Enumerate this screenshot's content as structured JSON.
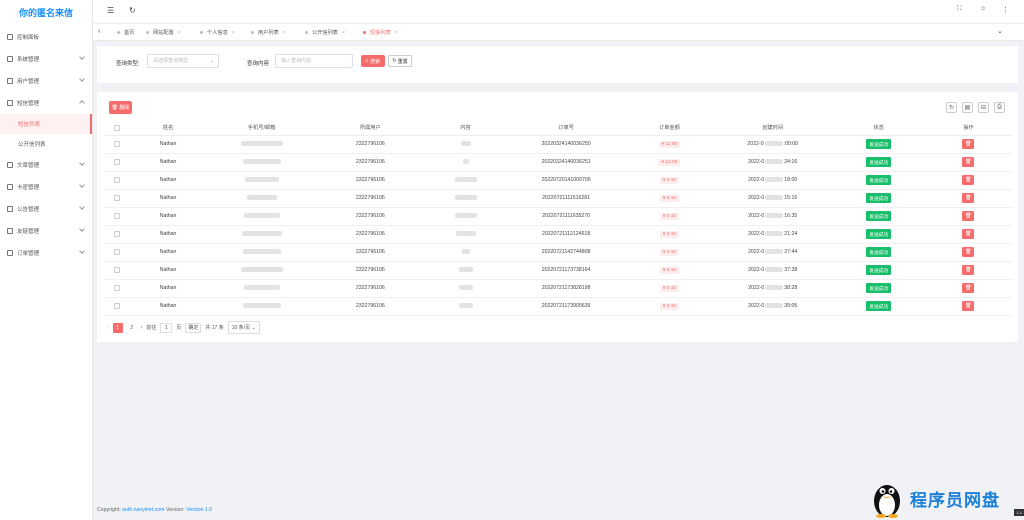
{
  "sidebar": {
    "logo": "你的匿名来信",
    "items": [
      {
        "label": "控制面板",
        "chev": false
      },
      {
        "label": "系统管理",
        "chev": true
      },
      {
        "label": "用户管理",
        "chev": true
      },
      {
        "label": "短信管理",
        "chev": true,
        "open": true
      }
    ],
    "subs": [
      {
        "label": "短信列表",
        "active": true
      },
      {
        "label": "公开信列表",
        "active": false
      }
    ],
    "items2": [
      {
        "label": "文章管理"
      },
      {
        "label": "卡密管理"
      },
      {
        "label": "公告管理"
      },
      {
        "label": "友链管理"
      },
      {
        "label": "订单管理"
      }
    ]
  },
  "tabs": [
    {
      "label": "首页",
      "close": false
    },
    {
      "label": "网站配置",
      "close": true
    },
    {
      "label": "个人信息",
      "close": true
    },
    {
      "label": "用户列表",
      "close": true
    },
    {
      "label": "公开信列表",
      "close": true
    },
    {
      "label": "短信列表",
      "close": true,
      "active": true
    }
  ],
  "search": {
    "type_label": "查询类型:",
    "type_placeholder": "请选择查询类型",
    "content_label": "查询内容",
    "content_placeholder": "输入查询内容",
    "search_btn": "搜索",
    "reset_btn": "重置"
  },
  "panel": {
    "delete_btn": "删除"
  },
  "table": {
    "headers": [
      "",
      "姓名",
      "手机号/邮箱",
      "所属用户",
      "内容",
      "订单号",
      "订单金额",
      "创建时间",
      "状态",
      "操作"
    ],
    "rows": [
      {
        "name": "Nathan",
        "user": "2322796106",
        "order": "20220324140036250",
        "amount": "¥ 11.00",
        "time_a": "2022-0",
        "time_b": ":00:00",
        "status": "发送成功"
      },
      {
        "name": "Nathan",
        "user": "2322796106",
        "order": "20220324140036251",
        "amount": "¥ 12.00",
        "time_a": "2022-0",
        "time_b": "24:16",
        "status": "发送成功"
      },
      {
        "name": "Nathan",
        "user": "2322796106",
        "order": "20220720141000705",
        "amount": "¥ 0.10",
        "time_a": "2022-0",
        "time_b": "18:00",
        "status": "发送成功"
      },
      {
        "name": "Nathan",
        "user": "2322796106",
        "order": "20220721111516281",
        "amount": "¥ 0.10",
        "time_a": "2022-0",
        "time_b": "15:16",
        "status": "发送成功"
      },
      {
        "name": "Nathan",
        "user": "2322796106",
        "order": "20220721111635270",
        "amount": "¥ 0.10",
        "time_a": "2022-0",
        "time_b": "16:35",
        "status": "发送成功"
      },
      {
        "name": "Nathan",
        "user": "2322796106",
        "order": "20220721112124618",
        "amount": "¥ 0.10",
        "time_a": "2022-0",
        "time_b": "21:24",
        "status": "发送成功"
      },
      {
        "name": "Nathan",
        "user": "2322796106",
        "order": "20220721142744808",
        "amount": "¥ 0.10",
        "time_a": "2022-0",
        "time_b": "27:44",
        "status": "发送成功"
      },
      {
        "name": "Nathan",
        "user": "2322796106",
        "order": "20220721173738164",
        "amount": "¥ 0.10",
        "time_a": "2022-0",
        "time_b": "37:38",
        "status": "发送成功"
      },
      {
        "name": "Nathan",
        "user": "2322796106",
        "order": "20220721173828198",
        "amount": "¥ 0.10",
        "time_a": "2022-0",
        "time_b": "38:28",
        "status": "发送成功"
      },
      {
        "name": "Nathan",
        "user": "2322796106",
        "order": "20220721173905639",
        "amount": "¥ 0.10",
        "time_a": "2022-0",
        "time_b": "39:05",
        "status": "发送成功"
      }
    ]
  },
  "pager": {
    "page1": "1",
    "page2": "2",
    "goto": "前往",
    "goto_val": "1",
    "page_unit": "页",
    "confirm": "确定",
    "total": "共 17 条",
    "size": "10 条/页"
  },
  "footer": {
    "copyright": "Copyright:",
    "site": "auth.nanyinet.com",
    "version_label": "Version:",
    "version": "Version 1.0"
  },
  "watermark": {
    "text": "程序员网盘",
    "badge": "1.1"
  },
  "colors": {
    "accent": "#f56c6c",
    "success": "#19be6b",
    "brand": "#1890ff"
  }
}
